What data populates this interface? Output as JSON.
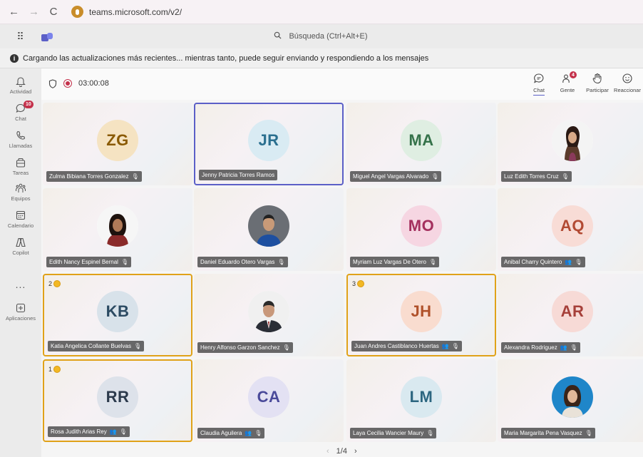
{
  "browser": {
    "back": "←",
    "forward": "→",
    "reload": "C",
    "url": "teams.microsoft.com/v2/"
  },
  "header": {
    "waffle": "⠿",
    "search_placeholder": "Búsqueda (Ctrl+Alt+E)"
  },
  "banner": {
    "text": "Cargando las actualizaciones más recientes... mientras tanto, puede seguir enviando y respondiendo a los mensajes"
  },
  "rail": {
    "items": [
      {
        "label": "Actividad"
      },
      {
        "label": "Chat",
        "badge": "10"
      },
      {
        "label": "Llamadas"
      },
      {
        "label": "Tareas"
      },
      {
        "label": "Equipos"
      },
      {
        "label": "Calendario"
      },
      {
        "label": "Copilot"
      },
      {
        "label": "..."
      },
      {
        "label": "Aplicaciones"
      }
    ]
  },
  "meeting": {
    "timer": "03:00:08",
    "toolbar": {
      "chat": "Chat",
      "people": "Gente",
      "people_badge": "4",
      "raise": "Participar",
      "react": "Reaccionar"
    }
  },
  "participants": [
    {
      "name": "Zulma Bibiana Torres Gonzalez",
      "initials": "ZG",
      "bg": "#f5e3c2",
      "fg": "#8a5a00"
    },
    {
      "name": "Jenny Patricia Torres Ramos",
      "initials": "JR",
      "bg": "#d9ebf3",
      "fg": "#2a6f8f"
    },
    {
      "name": "Miguel Angel Vargas Alvarado",
      "initials": "MA",
      "bg": "#dfeee2",
      "fg": "#35724a"
    },
    {
      "name": "Luz Edith Torres Cruz",
      "initials": "",
      "bg": "#ffffff",
      "fg": "#333"
    },
    {
      "name": "Edith Nancy Espinel Bernal",
      "initials": "",
      "bg": "#ffffff",
      "fg": "#333"
    },
    {
      "name": "Daniel Eduardo Otero Vargas",
      "initials": "",
      "bg": "#ffffff",
      "fg": "#333"
    },
    {
      "name": "Myriam Luz Vargas De Otero",
      "initials": "MO",
      "bg": "#f6d6e2",
      "fg": "#a4305e"
    },
    {
      "name": "Anibal Charry Quintero",
      "initials": "AQ",
      "bg": "#f8dcd6",
      "fg": "#b24a33"
    },
    {
      "name": "Katia Angelica Collante Buelvas",
      "initials": "KB",
      "bg": "#d8e2ea",
      "fg": "#2b4a62",
      "hand": "2"
    },
    {
      "name": "Henry Alfonso Garzon Sanchez",
      "initials": "",
      "bg": "#ffffff",
      "fg": "#333"
    },
    {
      "name": "Juan Andres Castiblanco Huertas",
      "initials": "JH",
      "bg": "#f9dccf",
      "fg": "#b0512a",
      "hand": "3"
    },
    {
      "name": "Alexandra Rodriguez",
      "initials": "AR",
      "bg": "#f7dad6",
      "fg": "#a6403a"
    },
    {
      "name": "Rosa Judith Arias Rey",
      "initials": "RR",
      "bg": "#dde2ea",
      "fg": "#2c3a4c",
      "hand": "1"
    },
    {
      "name": "Claudia Aguilera",
      "initials": "CA",
      "bg": "#e3e1f3",
      "fg": "#4a4a9a"
    },
    {
      "name": "Laya Cecilia Wancier Maury",
      "initials": "LM",
      "bg": "#d9e9f0",
      "fg": "#2c6680"
    },
    {
      "name": "Maria Margarita Pena Vasquez",
      "initials": "",
      "bg": "#ffffff",
      "fg": "#333"
    }
  ],
  "pager": {
    "prev": "‹",
    "label": "1/4",
    "next": "›"
  },
  "colors": {
    "accent": "#5b5fc7",
    "hand": "#e0a219",
    "alert": "#c4314b"
  }
}
